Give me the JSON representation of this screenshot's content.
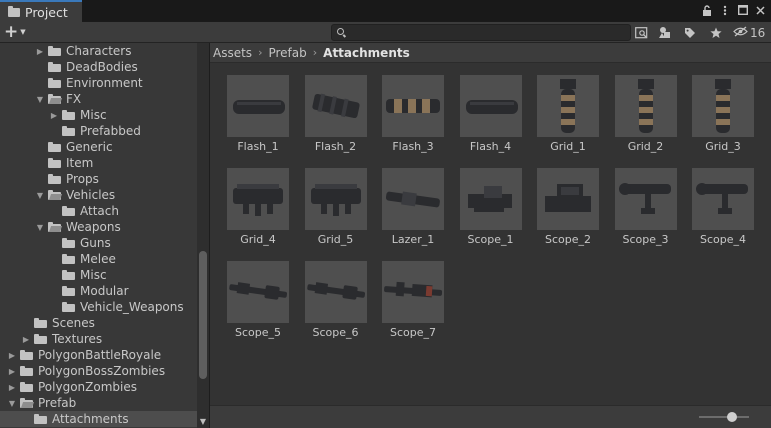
{
  "tab": {
    "title": "Project",
    "icon": "folder-icon"
  },
  "window_buttons": [
    {
      "name": "lock-icon",
      "glyph": "🔓"
    },
    {
      "name": "more-options-icon",
      "glyph": "⋮"
    },
    {
      "name": "maximize-icon",
      "glyph": "☐"
    },
    {
      "name": "close-icon",
      "glyph": "✕"
    }
  ],
  "toolbar": {
    "search": {
      "value": "",
      "placeholder": ""
    },
    "hidden_packages_count": "16"
  },
  "tree": {
    "items": [
      {
        "label": "Characters",
        "arrow": "▶",
        "indent": 3,
        "open": false
      },
      {
        "label": "DeadBodies",
        "arrow": "",
        "indent": 3,
        "open": false
      },
      {
        "label": "Environment",
        "arrow": "",
        "indent": 3,
        "open": false
      },
      {
        "label": "FX",
        "arrow": "▼",
        "indent": 3,
        "open": true
      },
      {
        "label": "Misc",
        "arrow": "▶",
        "indent": 4,
        "open": false
      },
      {
        "label": "Prefabbed",
        "arrow": "",
        "indent": 4,
        "open": false
      },
      {
        "label": "Generic",
        "arrow": "",
        "indent": 3,
        "open": false
      },
      {
        "label": "Item",
        "arrow": "",
        "indent": 3,
        "open": false
      },
      {
        "label": "Props",
        "arrow": "",
        "indent": 3,
        "open": false
      },
      {
        "label": "Vehicles",
        "arrow": "▼",
        "indent": 3,
        "open": true
      },
      {
        "label": "Attach",
        "arrow": "",
        "indent": 4,
        "open": false
      },
      {
        "label": "Weapons",
        "arrow": "▼",
        "indent": 3,
        "open": true
      },
      {
        "label": "Guns",
        "arrow": "",
        "indent": 4,
        "open": false
      },
      {
        "label": "Melee",
        "arrow": "",
        "indent": 4,
        "open": false
      },
      {
        "label": "Misc",
        "arrow": "",
        "indent": 4,
        "open": false
      },
      {
        "label": "Modular",
        "arrow": "",
        "indent": 4,
        "open": false
      },
      {
        "label": "Vehicle_Weapons",
        "arrow": "",
        "indent": 4,
        "open": false
      },
      {
        "label": "Scenes",
        "arrow": "",
        "indent": 2,
        "open": false
      },
      {
        "label": "Textures",
        "arrow": "▶",
        "indent": 2,
        "open": false
      },
      {
        "label": "PolygonBattleRoyale",
        "arrow": "▶",
        "indent": 1,
        "open": false
      },
      {
        "label": "PolygonBossZombies",
        "arrow": "▶",
        "indent": 1,
        "open": false
      },
      {
        "label": "PolygonZombies",
        "arrow": "▶",
        "indent": 1,
        "open": false
      },
      {
        "label": "Prefab",
        "arrow": "▼",
        "indent": 1,
        "open": true
      },
      {
        "label": "Attachments",
        "arrow": "",
        "indent": 2,
        "open": false,
        "selected": true
      }
    ]
  },
  "breadcrumb": [
    "Assets",
    "Prefab",
    "Attachments"
  ],
  "assets": [
    {
      "label": "Flash_1",
      "kind": "flash"
    },
    {
      "label": "Flash_2",
      "kind": "flash2"
    },
    {
      "label": "Flash_3",
      "kind": "flash3"
    },
    {
      "label": "Flash_4",
      "kind": "flash"
    },
    {
      "label": "Grid_1",
      "kind": "grip"
    },
    {
      "label": "Grid_2",
      "kind": "grip"
    },
    {
      "label": "Grid_3",
      "kind": "grip"
    },
    {
      "label": "Grid_4",
      "kind": "rail"
    },
    {
      "label": "Grid_5",
      "kind": "rail"
    },
    {
      "label": "Lazer_1",
      "kind": "lazer"
    },
    {
      "label": "Scope_1",
      "kind": "scope"
    },
    {
      "label": "Scope_2",
      "kind": "holo"
    },
    {
      "label": "Scope_3",
      "kind": "scopemount"
    },
    {
      "label": "Scope_4",
      "kind": "scopemount"
    },
    {
      "label": "Scope_5",
      "kind": "long"
    },
    {
      "label": "Scope_6",
      "kind": "long"
    },
    {
      "label": "Scope_7",
      "kind": "long2"
    }
  ],
  "colors": {
    "accent": "#3a79bb",
    "selection": "#4d4d4d",
    "thumb_bg": "#4f4f4f"
  },
  "zoom_slider": {
    "value": 0.6
  }
}
